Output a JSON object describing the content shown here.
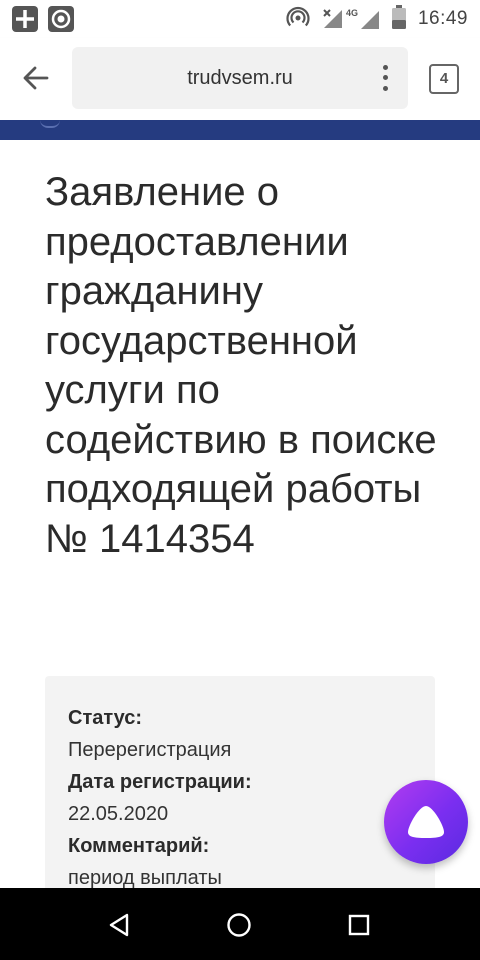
{
  "status_bar": {
    "time": "16:49",
    "network": "4G",
    "icons": [
      "plus-icon",
      "record-icon",
      "hotspot-icon",
      "signal-icon",
      "battery-icon"
    ]
  },
  "browser": {
    "url": "trudvsem.ru",
    "tab_count": "4",
    "icons": [
      "back-arrow-icon",
      "more-vert-icon",
      "tabs-icon"
    ]
  },
  "page": {
    "title": "Заявление о предоставлении гражданину государственной услуги по содействию в поиске подходящей работы № 1414354",
    "info": [
      {
        "label": "Статус:",
        "value": "Перерегистрация"
      },
      {
        "label": "Дата регистрации:",
        "value": "22.05.2020"
      },
      {
        "label": "Комментарий:",
        "value": "период выплаты"
      }
    ]
  },
  "colors": {
    "header": "#253b80",
    "card": "#f3f3f3",
    "alice_gradient_start": "#b23cf0",
    "alice_gradient_end": "#5a2be0"
  },
  "nav_bar": {
    "icons": [
      "back-triangle-icon",
      "home-circle-icon",
      "recents-square-icon"
    ]
  }
}
